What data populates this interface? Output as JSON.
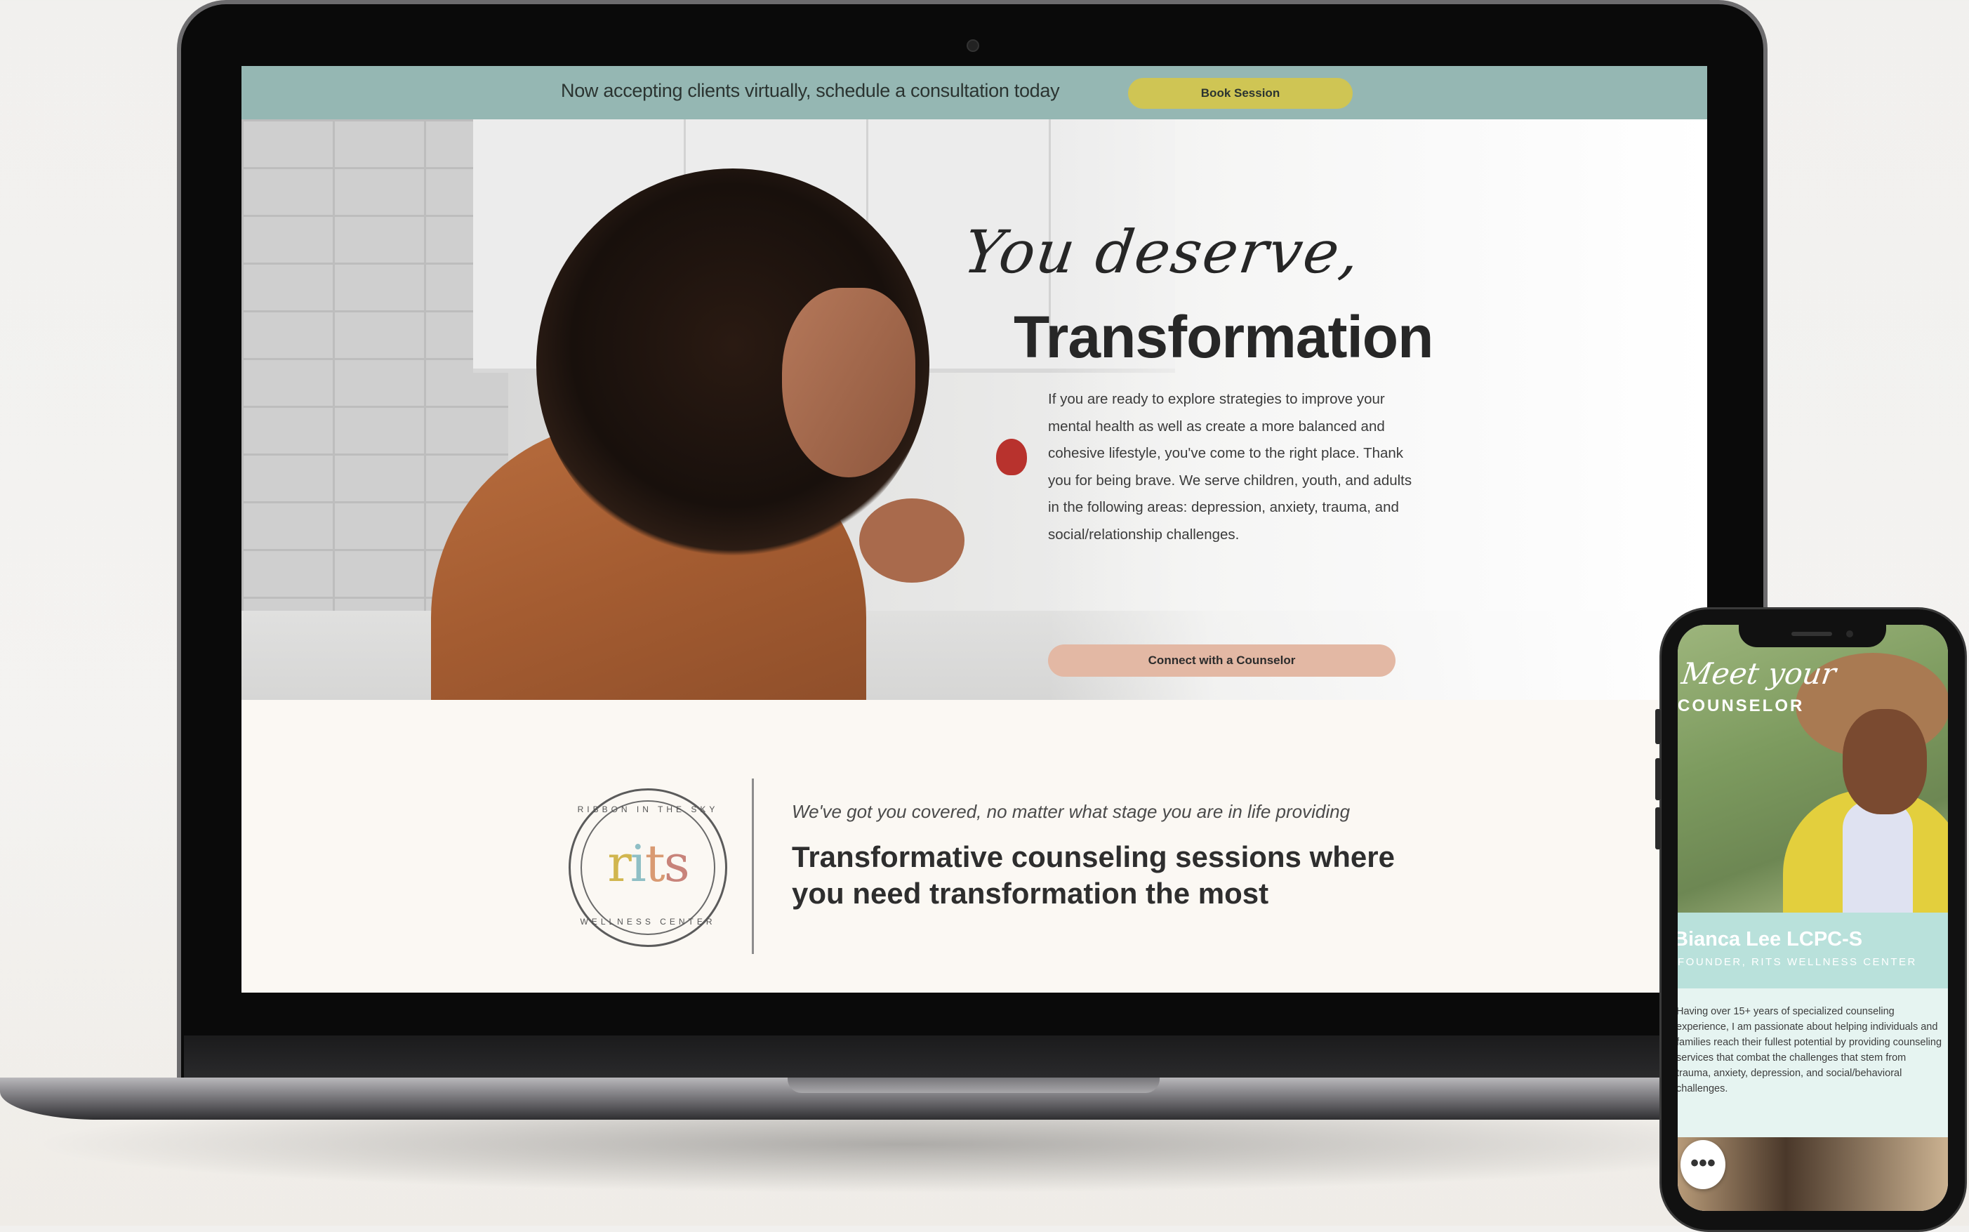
{
  "banner": {
    "text": "Now accepting clients virtually, schedule a consultation today",
    "book_label": "Book Session",
    "bg_color": "#95b7b3",
    "button_color": "#cfc554"
  },
  "hero": {
    "script_title": "You deserve,",
    "title": "Transformation",
    "body": "If you are ready to explore strategies to improve your mental health as well as create a more balanced and cohesive lifestyle, you've come to the right place. Thank you for being brave. We serve children, youth, and adults in the following areas: depression, anxiety, trauma, and social/relationship challenges.",
    "cta_label": "Connect with a Counselor",
    "cta_color": "#e3b8a4"
  },
  "intro": {
    "logo_word": "rits",
    "logo_ring_top": "RIBBON IN THE SKY",
    "logo_ring_bottom": "WELLNESS CENTER",
    "subtitle": "We've got you covered, no matter what stage you are in life providing",
    "title": "Transformative counseling sessions where you need transformation the most"
  },
  "phone": {
    "script_title": "Meet your",
    "caps_title": "COUNSELOR",
    "name": "Bianca Lee LCPC-S",
    "role": "FOUNDER, RITS WELLNESS CENTER",
    "body": "Having over 15+ years of specialized counseling experience, I am passionate about helping individuals and families reach their fullest potential by providing counseling services that combat the challenges that stem from trauma, anxiety, depression, and social/behavioral challenges.",
    "chat_icon": "chat-dots-icon",
    "accent_color": "#b9e1db"
  }
}
